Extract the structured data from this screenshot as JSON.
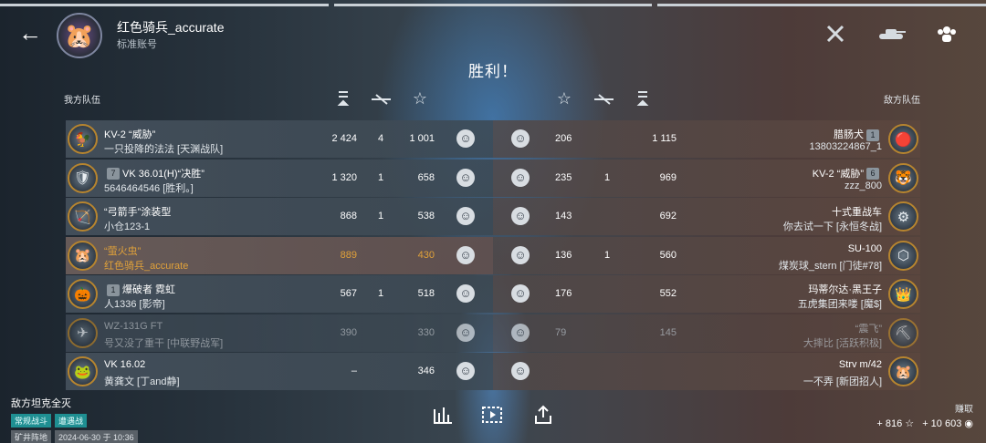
{
  "header": {
    "player_name": "红色骑兵_accurate",
    "account_type": "标准账号",
    "result": "胜利！",
    "icons": [
      "crossed-swords-icon",
      "tank-icon",
      "team-icon"
    ]
  },
  "teams": {
    "ally_label": "我方队伍",
    "enemy_label": "敌方队伍"
  },
  "rows": [
    {
      "ally": {
        "tank": "KV-2 “威胁”",
        "player": "一只投降的法法 [天渊战队]",
        "rank": "",
        "dmg": "2 424",
        "kills": "4",
        "exp": "1 001"
      },
      "enemy": {
        "tank": "腊肠犬",
        "player": "13803224867_1",
        "rank": "1",
        "dmg": "1 115",
        "kills": "",
        "exp": "206"
      }
    },
    {
      "ally": {
        "tank": "VK 36.01(H)“决胜”",
        "player": "5646464546 [胜利。]",
        "rank": "7",
        "dmg": "1 320",
        "kills": "1",
        "exp": "658"
      },
      "enemy": {
        "tank": "KV-2 “威胁”",
        "player": "zzz_800",
        "rank": "6",
        "dmg": "969",
        "kills": "1",
        "exp": "235"
      }
    },
    {
      "ally": {
        "tank": "“弓箭手”涂装型",
        "player": "小仓123-1",
        "rank": "",
        "dmg": "868",
        "kills": "1",
        "exp": "538"
      },
      "enemy": {
        "tank": "十式重战车",
        "player": "你去试一下 [永恒冬战]",
        "rank": "",
        "dmg": "692",
        "kills": "",
        "exp": "143"
      }
    },
    {
      "ally": {
        "tank": "“萤火虫”",
        "player": "红色骑兵_accurate",
        "rank": "",
        "dmg": "889",
        "kills": "",
        "exp": "430"
      },
      "enemy": {
        "tank": "SU-100",
        "player": "煤炭球_stern [门徒#78]",
        "rank": "",
        "dmg": "560",
        "kills": "1",
        "exp": "136"
      }
    },
    {
      "ally": {
        "tank": "爆破者 霓虹",
        "player": "人1336 [影帝]",
        "rank": "1",
        "dmg": "567",
        "kills": "1",
        "exp": "518"
      },
      "enemy": {
        "tank": "玛蒂尔达·黑王子",
        "player": "五虎集团来喽 [魔$]",
        "rank": "",
        "dmg": "552",
        "kills": "",
        "exp": "176"
      }
    },
    {
      "ally": {
        "tank": "WZ-131G FT",
        "player": "号又没了重干 [中联野战军]",
        "rank": "",
        "dmg": "390",
        "kills": "",
        "exp": "330"
      },
      "enemy": {
        "tank": "“震飞”",
        "player": "大摔比 [活跃积极]",
        "rank": "",
        "dmg": "145",
        "kills": "",
        "exp": "79"
      }
    },
    {
      "ally": {
        "tank": "VK 16.02",
        "player": "黄龚文 [丁and静]",
        "rank": "",
        "dmg": "–",
        "kills": "",
        "exp": "346"
      },
      "enemy": {
        "tank": "Strv m/42",
        "player": "一不弄 [新团招人]",
        "rank": "",
        "dmg": "",
        "kills": "",
        "exp": ""
      }
    }
  ],
  "footer": {
    "result_reason": "敌方坦克全灭",
    "mode_tags": [
      "常规战斗",
      "遭遇战"
    ],
    "map": "矿井阵地",
    "datetime": "2024-06-30 于 10:36",
    "earn_label": "赚取",
    "exp_earned": "+ 816",
    "credits_earned": "+ 10 603"
  }
}
